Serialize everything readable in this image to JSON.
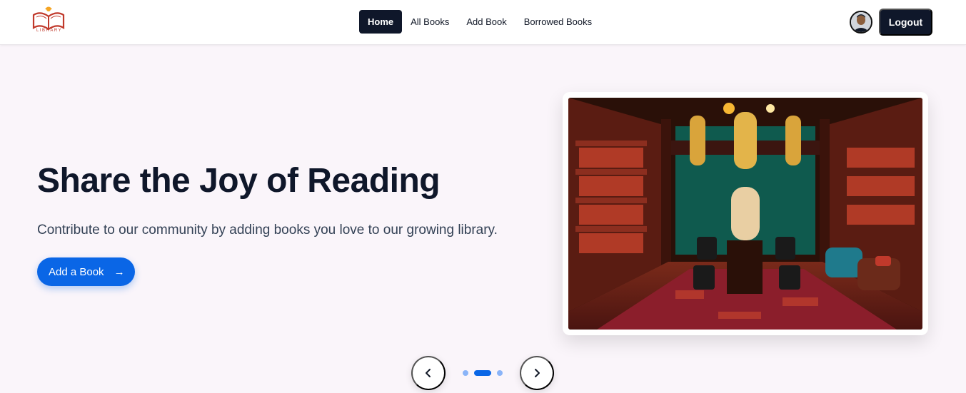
{
  "nav": {
    "logo_text": "LIBRARY",
    "links": [
      {
        "label": "Home",
        "active": true
      },
      {
        "label": "All Books",
        "active": false
      },
      {
        "label": "Add Book",
        "active": false
      },
      {
        "label": "Borrowed Books",
        "active": false
      }
    ],
    "logout_label": "Logout"
  },
  "hero": {
    "title": "Share the Joy of Reading",
    "subtitle": "Contribute to our community by adding books you love to our growing library.",
    "cta_label": "Add a Book",
    "cta_icon": "arrow-right-icon",
    "image_alt": "library-interior-image"
  },
  "carousel": {
    "slide_count": 3,
    "active_index": 1,
    "prev_icon": "chevron-left-icon",
    "next_icon": "chevron-right-icon"
  },
  "colors": {
    "primary": "#0a66e6",
    "dark": "#0f172a",
    "background": "#faf5fa"
  }
}
